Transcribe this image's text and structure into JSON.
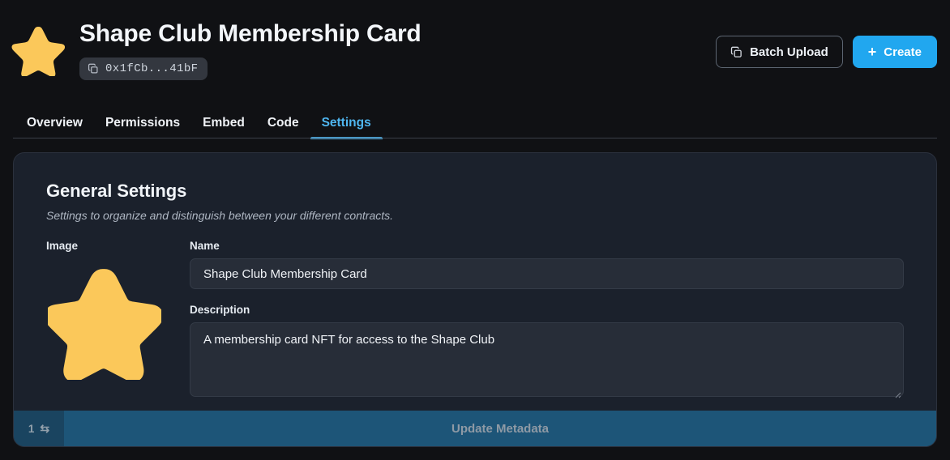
{
  "header": {
    "logo_icon": "star-icon",
    "title": "Shape Club Membership Card",
    "address": "0x1fCb...41bF",
    "copy_icon": "copy-icon",
    "batch_upload_label": "Batch Upload",
    "batch_upload_icon": "stack-icon",
    "create_label": "Create",
    "create_icon": "plus-icon",
    "accent_blue": "#21a7ef"
  },
  "tabs": [
    {
      "label": "Overview",
      "active": false
    },
    {
      "label": "Permissions",
      "active": false
    },
    {
      "label": "Embed",
      "active": false
    },
    {
      "label": "Code",
      "active": false
    },
    {
      "label": "Settings",
      "active": true
    }
  ],
  "settings": {
    "section_title": "General Settings",
    "section_subtitle": "Settings to organize and distinguish between your different contracts.",
    "image_label": "Image",
    "image_icon": "star-icon",
    "name_label": "Name",
    "name_value": "Shape Club Membership Card",
    "name_placeholder": "Name",
    "description_label": "Description",
    "description_value": "A membership card NFT for access to the Shape Club",
    "description_placeholder": "Description",
    "resize_icon": "resize-grip-icon"
  },
  "footer": {
    "fee_count": "1",
    "fee_icon": "swap-arrows-icon",
    "update_label": "Update Metadata",
    "bar_color": "#1d5578",
    "fee_color": "#1a4460"
  }
}
